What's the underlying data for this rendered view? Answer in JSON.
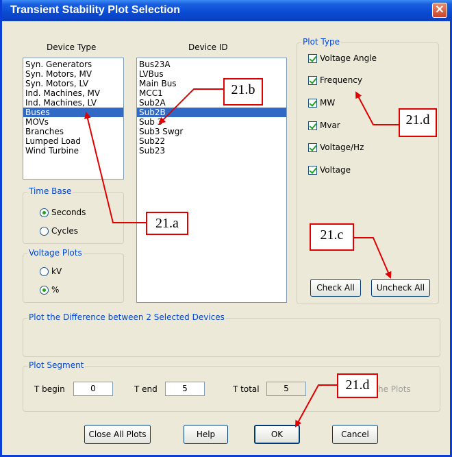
{
  "window": {
    "title": "Transient Stability Plot Selection",
    "close_glyph": "✕"
  },
  "device_type": {
    "header": "Device Type",
    "items": [
      "Syn. Generators",
      "Syn. Motors, MV",
      "Syn. Motors, LV",
      "Ind. Machines, MV",
      "Ind. Machines, LV",
      "Buses",
      "MOVs",
      "Branches",
      "Lumped Load",
      "Wind Turbine"
    ],
    "selected": "Buses"
  },
  "device_id": {
    "header": "Device ID",
    "items": [
      "Bus23A",
      "LVBus",
      "Main Bus",
      "MCC1",
      "Sub2A",
      "Sub2B",
      "Sub 3",
      "Sub3 Swgr",
      "Sub22",
      "Sub23"
    ],
    "selected": "Sub2B"
  },
  "time_base": {
    "legend": "Time Base",
    "options": [
      "Seconds",
      "Cycles"
    ],
    "selected": "Seconds"
  },
  "voltage_plots": {
    "legend": "Voltage Plots",
    "options": [
      "kV",
      "%"
    ],
    "selected": "%"
  },
  "plot_type": {
    "legend": "Plot Type",
    "options": [
      {
        "label": "Voltage Angle",
        "checked": true
      },
      {
        "label": "Frequency",
        "checked": true
      },
      {
        "label": "MW",
        "checked": true
      },
      {
        "label": "Mvar",
        "checked": true
      },
      {
        "label": "Voltage/Hz",
        "checked": true
      },
      {
        "label": "Voltage",
        "checked": true
      }
    ],
    "check_all": "Check All",
    "uncheck_all": "Uncheck All"
  },
  "difference": {
    "legend": "Plot the Difference between 2 Selected Devices"
  },
  "plot_segment": {
    "legend": "Plot Segment",
    "t_begin_label": "T begin",
    "t_begin": "0",
    "t_end_label": "T end",
    "t_end": "5",
    "t_total_label": "T total",
    "t_total": "5",
    "combine_label": "he Plots"
  },
  "buttons": {
    "close_all": "Close All Plots",
    "help": "Help",
    "ok": "OK",
    "cancel": "Cancel"
  },
  "annotations": {
    "a": "21.a",
    "b": "21.b",
    "c": "21.c",
    "d1": "21.d",
    "d2": "21.d"
  },
  "colors": {
    "title_bar": "#0a4ad2",
    "dialog_bg": "#ece9d8",
    "selection": "#316ac5",
    "legend_text": "#0046d5",
    "annotation": "#e00000"
  }
}
